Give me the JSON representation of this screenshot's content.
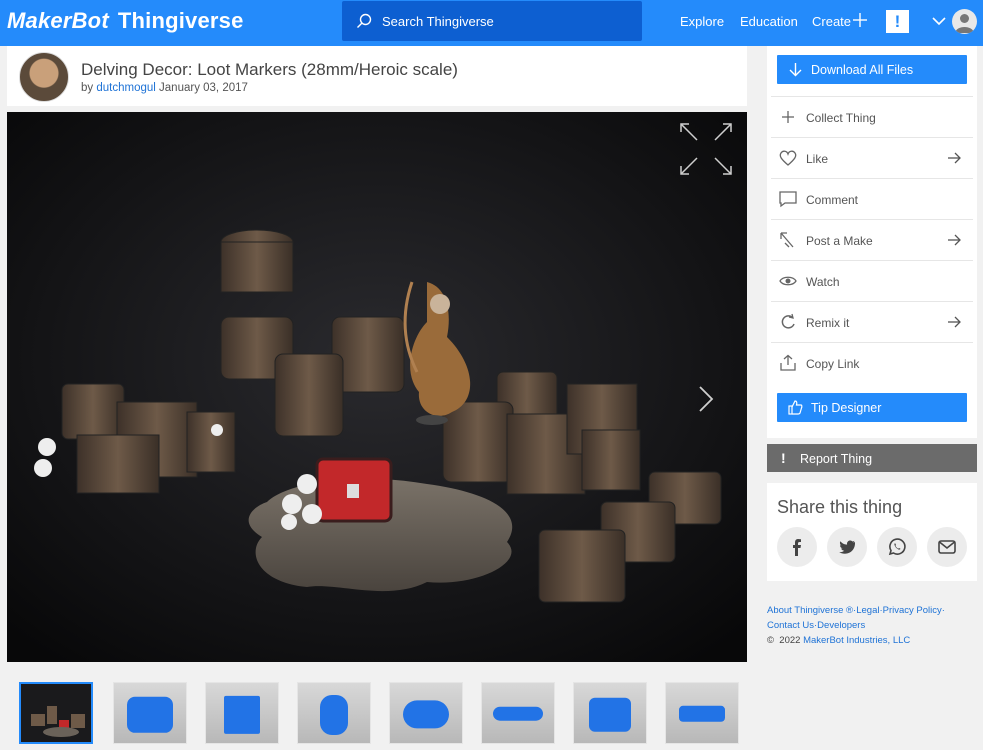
{
  "nav": {
    "logo_brand": "MakerBot",
    "logo_product": "Thingiverse",
    "search_placeholder": "Search Thingiverse",
    "explore": "Explore",
    "education": "Education",
    "create": "Create",
    "alert": "!"
  },
  "thing": {
    "title": "Delving Decor: Loot Markers (28mm/Heroic scale)",
    "by": "by",
    "author": "dutchmogul",
    "date": "January 03, 2017"
  },
  "sidebar": {
    "download": "Download All Files",
    "actions": [
      {
        "label": "Collect Thing",
        "icon": "plus-icon",
        "arrow": false
      },
      {
        "label": "Like",
        "icon": "heart-icon",
        "arrow": true
      },
      {
        "label": "Comment",
        "icon": "comment-icon",
        "arrow": false
      },
      {
        "label": "Post a Make",
        "icon": "make-icon",
        "arrow": true
      },
      {
        "label": "Watch",
        "icon": "eye-icon",
        "arrow": false
      },
      {
        "label": "Remix it",
        "icon": "remix-icon",
        "arrow": true
      },
      {
        "label": "Copy Link",
        "icon": "share-link-icon",
        "arrow": false
      }
    ],
    "tip": "Tip Designer",
    "report": "Report Thing"
  },
  "share": {
    "heading": "Share this thing",
    "networks": [
      "facebook-icon",
      "twitter-icon",
      "whatsapp-icon",
      "email-icon"
    ]
  },
  "footer": {
    "about": "About Thingiverse ®",
    "sep": "·",
    "legal": "Legal",
    "privacy": "Privacy Policy",
    "contact": "Contact Us",
    "developers": "Developers",
    "copy_symbol": "©",
    "copyright_year": "2022",
    "company": "MakerBot Industries, LLC"
  },
  "colors": {
    "brand_blue": "#248bfb",
    "search_bg": "#0d5fd1",
    "report_gray": "#6b6b6b",
    "link_blue": "#1f73d6"
  }
}
